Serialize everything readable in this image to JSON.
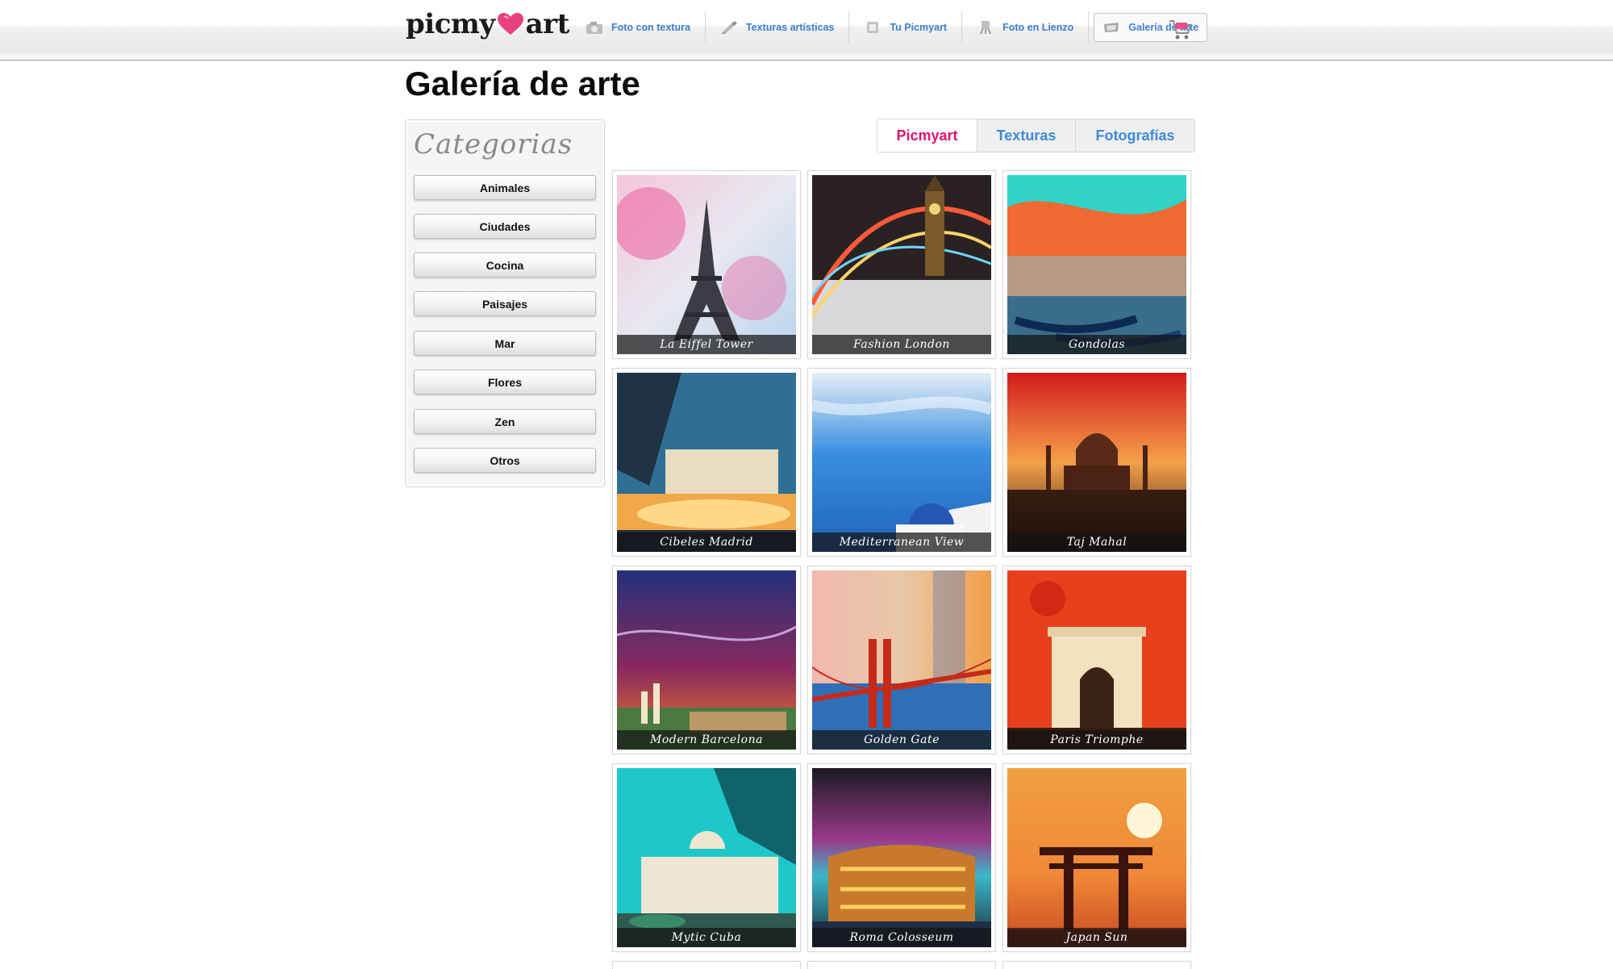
{
  "header": {
    "logo_left": "picmy",
    "logo_right": "art",
    "nav": [
      {
        "label": "Foto con textura",
        "icon": "camera-icon"
      },
      {
        "label": "Texturas artísticas",
        "icon": "brush-icon"
      },
      {
        "label": "Tu Picmyart",
        "icon": "frame-icon"
      },
      {
        "label": "Foto en Lienzo",
        "icon": "easel-icon"
      },
      {
        "label": "Galería de arte",
        "icon": "gallery-icon"
      }
    ],
    "cart_icon": "cart-icon"
  },
  "page": {
    "title": "Galería de arte"
  },
  "sidebar": {
    "title": "Categorias",
    "categories": [
      "Animales",
      "Ciudades",
      "Cocina",
      "Paisajes",
      "Mar",
      "Flores",
      "Zen",
      "Otros"
    ]
  },
  "tabs": [
    "Picmyart",
    "Texturas",
    "Fotografías"
  ],
  "gallery": {
    "items": [
      "La Eiffel Tower",
      "Fashion London",
      "Gondolas",
      "Cibeles Madrid",
      "Mediterranean View",
      "Taj Mahal",
      "Modern Barcelona",
      "Golden Gate",
      "Paris Triomphe",
      "Mytic Cuba",
      "Roma Colosseum",
      "Japan Sun"
    ]
  },
  "colors": {
    "accent_pink": "#e0136a",
    "link_blue": "#3e8ad6"
  }
}
